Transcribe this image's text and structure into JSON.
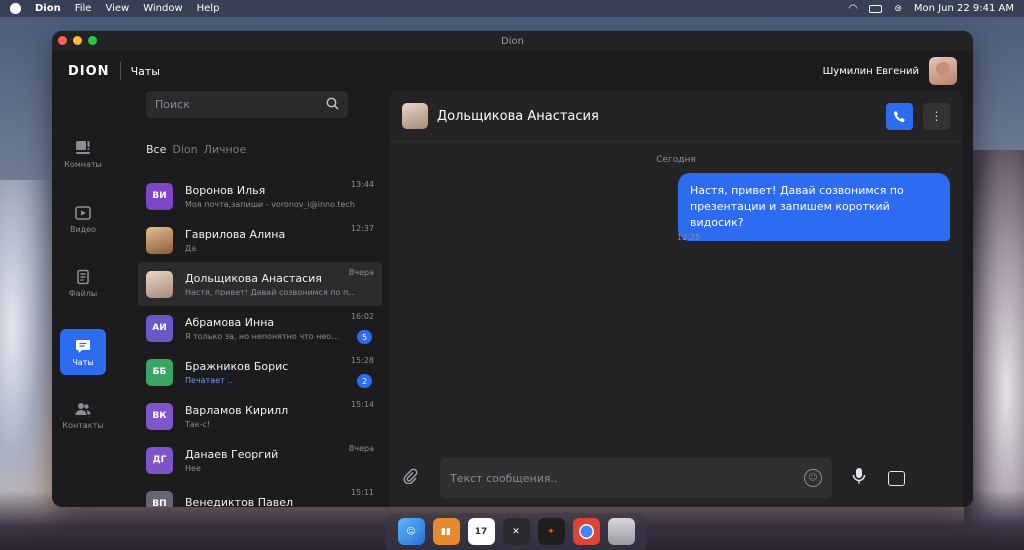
{
  "menubar": {
    "app": "Dion",
    "items": [
      "File",
      "View",
      "Window",
      "Help"
    ],
    "datetime": "Mon Jun 22  9:41 AM"
  },
  "window": {
    "title": "Dion"
  },
  "header": {
    "logo": "DION",
    "section": "Чаты",
    "user_name": "Шумилин Евгений"
  },
  "rail": [
    {
      "label": "Комнаты",
      "icon": "rooms-icon"
    },
    {
      "label": "Видео",
      "icon": "video-icon"
    },
    {
      "label": "Файлы",
      "icon": "files-icon"
    },
    {
      "label": "Чаты",
      "icon": "chat-icon",
      "active": true
    },
    {
      "label": "Контакты",
      "icon": "contacts-icon"
    }
  ],
  "search": {
    "placeholder": "Поиск"
  },
  "filters": [
    "Все",
    "Dion",
    "Личное"
  ],
  "chats": [
    {
      "initials": "ВИ",
      "color": "#7e45c9",
      "name": "Воронов Илья",
      "preview": "Моя почта,запиши - voronov_i@inno.tech",
      "time": "13:44"
    },
    {
      "initials": "",
      "color": "",
      "name": "Гаврилова Алина",
      "preview": "Да",
      "time": "12:37"
    },
    {
      "initials": "",
      "color": "",
      "name": "Дольщикова Анастасия",
      "preview": "Настя, привет! Давай созвонимся по презен...",
      "time": "Вчера"
    },
    {
      "initials": "АИ",
      "color": "#6a58c6",
      "name": "Абрамова Инна",
      "preview": "Я только за, но непонятно что необх...",
      "time": "16:02",
      "badge": "5"
    },
    {
      "initials": "ББ",
      "color": "#3aa462",
      "name": "Бражников Борис",
      "preview": "Печатает ..",
      "time": "15:28",
      "badge": "2"
    },
    {
      "initials": "ВК",
      "color": "#7f56cc",
      "name": "Варламов Кирилл",
      "preview": "Так-с!",
      "time": "15:14"
    },
    {
      "initials": "ДГ",
      "color": "#7e55c9",
      "name": "Данаев Георгий",
      "preview": "Нее",
      "time": "Вчера"
    },
    {
      "initials": "ВП",
      "color": "#666670",
      "name": "Венедиктов Павел",
      "preview": "",
      "time": "15:11"
    }
  ],
  "conversation": {
    "name": "Дольщикова Анастасия",
    "day": "Сегодня",
    "message": "Настя, привет! Давай созвонимся по презентации и запишем короткий видосик?",
    "message_time": "12:25",
    "input_placeholder": "Текст сообщения.."
  },
  "colors": {
    "accent": "#2d6bf0",
    "bg": "#1c1c1e",
    "panel": "#242427"
  }
}
